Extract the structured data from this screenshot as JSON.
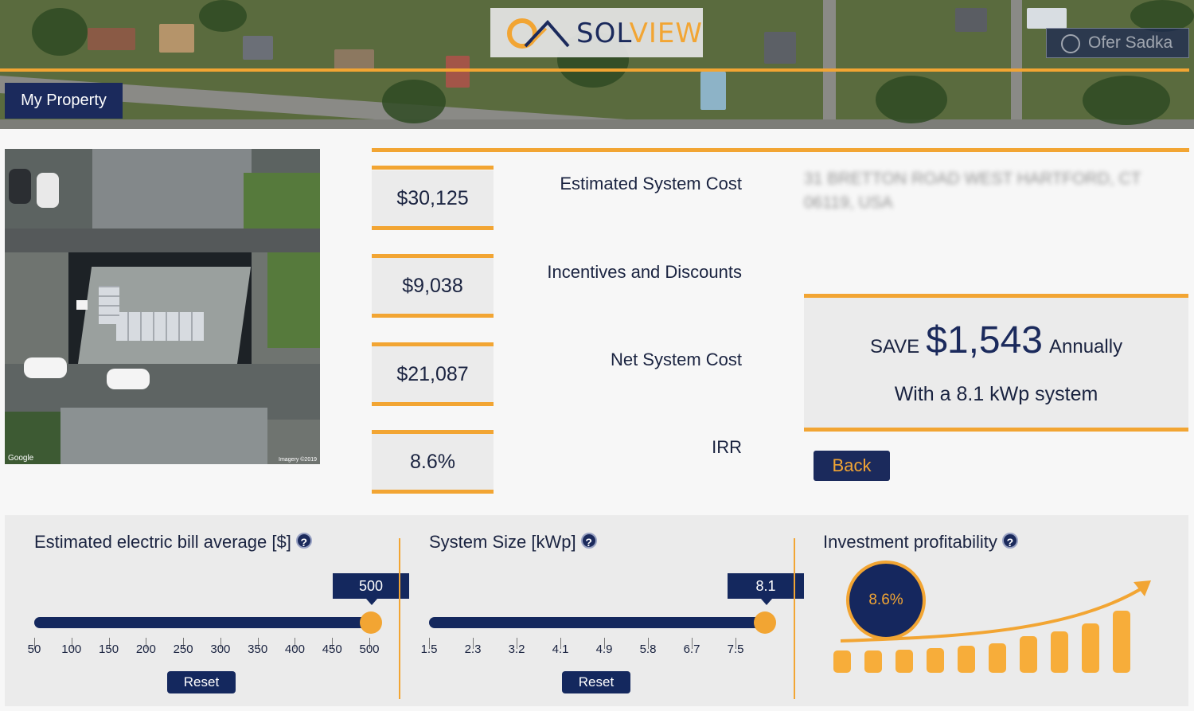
{
  "header": {
    "logo_text_part1": "SOL",
    "logo_text_part2": "VIEW",
    "user_name": "Ofer Sadka",
    "nav_label": "My Property"
  },
  "map": {
    "attribution_left": "Google",
    "attribution_right": "Imagery ©2019"
  },
  "metrics": [
    {
      "label": "Estimated System Cost",
      "value": "$30,125"
    },
    {
      "label": "Incentives and Discounts",
      "value": "$9,038"
    },
    {
      "label": "Net System Cost",
      "value": "$21,087"
    },
    {
      "label": "IRR",
      "value": "8.6%"
    }
  ],
  "address": "31 BRETTON ROAD WEST HARTFORD, CT 06119, USA",
  "savings": {
    "save_prefix": "SAVE",
    "amount": "$1,543",
    "save_suffix": "Annually",
    "system_line": "With a 8.1 kWp system"
  },
  "back_label": "Back",
  "bill_slider": {
    "title": "Estimated electric bill average [$]",
    "value": "500",
    "ticks": [
      "50",
      "100",
      "150",
      "200",
      "250",
      "300",
      "350",
      "400",
      "450",
      "500"
    ],
    "reset_label": "Reset",
    "fill_fraction": 1.0
  },
  "size_slider": {
    "title": "System Size [kWp]",
    "value": "8.1",
    "ticks": [
      "1.5",
      "2.3",
      "3.2",
      "4.1",
      "4.9",
      "5.8",
      "6.7",
      "7.5"
    ],
    "reset_label": "Reset",
    "fill_fraction": 1.0
  },
  "profitability": {
    "title": "Investment profitability",
    "irr": "8.6%"
  },
  "help_glyph": "?",
  "colors": {
    "accent": "#f2a533",
    "navy": "#1b2a5c"
  }
}
